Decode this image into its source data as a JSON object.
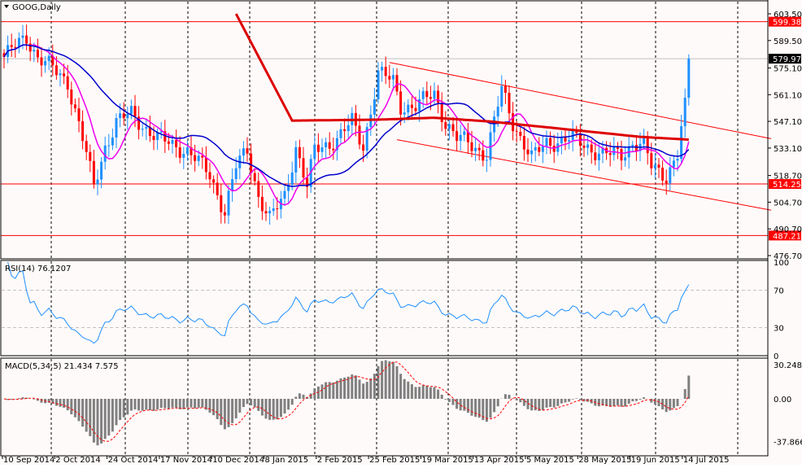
{
  "symbol_label": "GOOG,Daily",
  "colors": {
    "bull": "#1e90ff",
    "bear": "#ff0000",
    "ma_fast": "#ee00ee",
    "ma_mid": "#0000cc",
    "ma_slow": "#dd0000",
    "rsi": "#1e90ff",
    "macd_hist": "#808080",
    "macd_signal": "#ff0000",
    "background": "#fffafa"
  },
  "chart_data": {
    "type": "candlestick",
    "title": "GOOG,Daily",
    "price_axis": {
      "min": 476.7,
      "max": 603.5,
      "ticks": [
        "603.50",
        "589.50",
        "575.10",
        "561.10",
        "547.10",
        "533.10",
        "518.70",
        "504.70",
        "490.70",
        "476.70"
      ]
    },
    "levels": [
      {
        "price": 599.38,
        "label": "599.38"
      },
      {
        "price": 514.25,
        "label": "514.25"
      },
      {
        "price": 487.21,
        "label": "487.21"
      }
    ],
    "current_price": {
      "price": 579.97,
      "label": "579.97"
    },
    "close_keypoints": [
      [
        0,
        580.9
      ],
      [
        6,
        591.5
      ],
      [
        9,
        580.9
      ],
      [
        17,
        568
      ],
      [
        21,
        538
      ],
      [
        24,
        512.5
      ],
      [
        27,
        534
      ],
      [
        30,
        546.7
      ],
      [
        34,
        551
      ],
      [
        41,
        538
      ],
      [
        49,
        531.8
      ],
      [
        55,
        519
      ],
      [
        59,
        499.7
      ],
      [
        62,
        523
      ],
      [
        65,
        532
      ],
      [
        68,
        508
      ],
      [
        71,
        495.5
      ],
      [
        75,
        508
      ],
      [
        78,
        534
      ],
      [
        81,
        512.5
      ],
      [
        83,
        531.8
      ],
      [
        89,
        538
      ],
      [
        93,
        546.7
      ],
      [
        96,
        534
      ],
      [
        100,
        572.3
      ],
      [
        104,
        568
      ],
      [
        106,
        555.2
      ],
      [
        110,
        555
      ],
      [
        115,
        561.7
      ],
      [
        118,
        546.7
      ],
      [
        121,
        538
      ],
      [
        124,
        536
      ],
      [
        129,
        529.6
      ],
      [
        133,
        563.8
      ],
      [
        136,
        546.7
      ],
      [
        141,
        527.5
      ],
      [
        145,
        536
      ],
      [
        152,
        538
      ],
      [
        156,
        534
      ],
      [
        160,
        529.6
      ],
      [
        165,
        529.6
      ],
      [
        168,
        536
      ],
      [
        171,
        534
      ],
      [
        173,
        523.2
      ],
      [
        177,
        519
      ],
      [
        180,
        529.6
      ],
      [
        182,
        559.5
      ],
      [
        183,
        579.97
      ]
    ],
    "ma_slow_keypoints": [
      [
        62,
        603.5
      ],
      [
        77,
        547.5
      ],
      [
        100,
        548
      ],
      [
        115,
        549
      ],
      [
        130,
        547
      ],
      [
        150,
        543
      ],
      [
        170,
        539
      ],
      [
        183,
        537.5
      ]
    ],
    "channel": {
      "upper": [
        [
          103,
          578
        ],
        [
          205,
          538
        ]
      ],
      "lower": [
        [
          105,
          537.5
        ],
        [
          205,
          500.5
        ]
      ]
    },
    "x_labels": [
      "10 Sep 2014",
      "2 Oct 2014",
      "24 Oct 2014",
      "17 Nov 2014",
      "10 Dec 2014",
      "8 Jan 2015",
      "2 Feb 2015",
      "25 Feb 2015",
      "19 Mar 2015",
      "13 Apr 2015",
      "5 May 2015",
      "28 May 2015",
      "19 Jun 2015",
      "14 Jul 2015"
    ],
    "rsi": {
      "label": "RSI(14) 76.1207",
      "axis": {
        "min": 0,
        "max": 100
      },
      "ticks": [
        "100",
        "70",
        "30",
        "0"
      ],
      "levels": [
        70,
        30
      ]
    },
    "macd": {
      "label": "MACD(5,34,5) 21.434 7.575",
      "ticks": [
        "30.248",
        "0.00",
        "-37.866"
      ],
      "axis": {
        "min": -37.866,
        "max": 30.248
      }
    }
  }
}
